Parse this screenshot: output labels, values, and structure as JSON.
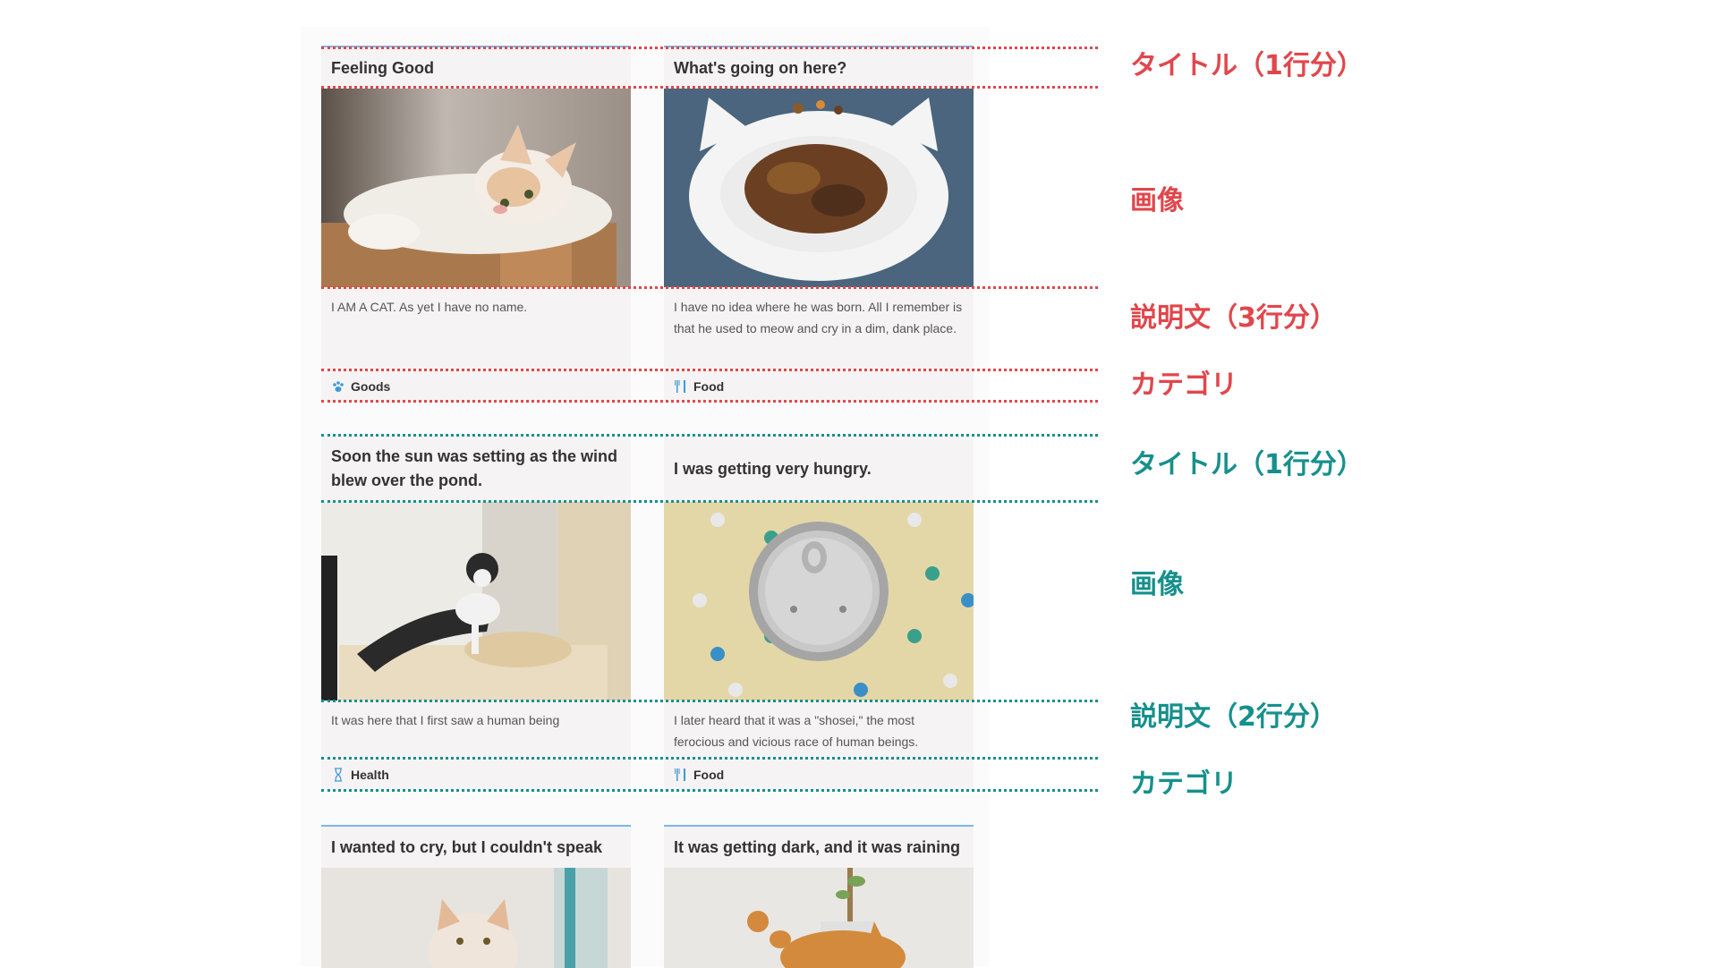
{
  "cards": [
    {
      "title": "Feeling Good",
      "description": "I AM A CAT. As yet I have no name.",
      "category": "Goods",
      "category_icon": "paw-icon"
    },
    {
      "title": "What's going on here?",
      "description": "I have no idea where he was born. All I remember is that he used to meow and cry in a dim, dank place.",
      "category": "Food",
      "category_icon": "fork-knife-icon"
    },
    {
      "title": "Soon the sun was setting as the wind blew over the pond.",
      "description": "It was here that I first saw a human being",
      "category": "Health",
      "category_icon": "hourglass-icon"
    },
    {
      "title": "I was getting very hungry.",
      "description": "I later heard that it was a \"shosei,\" the most ferocious and vicious race of human beings.",
      "category": "Food",
      "category_icon": "fork-knife-icon"
    },
    {
      "title": "I wanted to cry, but I couldn't speak"
    },
    {
      "title": "It was getting dark, and it was raining"
    }
  ],
  "annotations": {
    "red": {
      "title": "タイトル（1行分）",
      "image": "画像",
      "description": "説明文（3行分）",
      "category": "カテゴリ"
    },
    "teal": {
      "title": "タイトル（1行分）",
      "image": "画像",
      "description": "説明文（2行分）",
      "category": "カテゴリ"
    }
  },
  "colors": {
    "annotation_red": "#e0474c",
    "annotation_teal": "#16908c",
    "card_accent": "#7ab8e6",
    "card_bg": "#f5f3f3",
    "icon_blue": "#3f9ad6"
  }
}
